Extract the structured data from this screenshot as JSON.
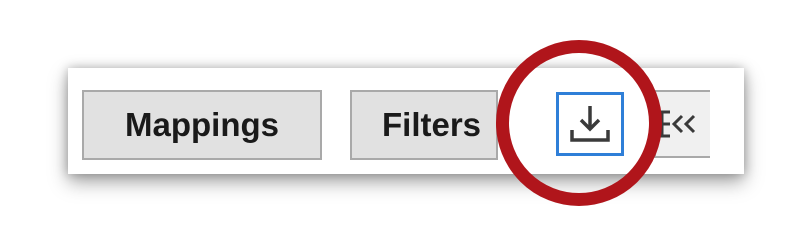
{
  "toolbar": {
    "mappings_label": "Mappings",
    "filters_label": "Filters",
    "download_icon": "download-icon",
    "collapse_icon": "collapse-panel-icon"
  },
  "annotation": {
    "type": "highlight-circle",
    "color": "#b0151b"
  },
  "colors": {
    "button_face": "#e1e1e1",
    "button_border": "#a9a9a9",
    "focus_border": "#2f7fd8",
    "icon_stroke": "#3a3a3a"
  }
}
